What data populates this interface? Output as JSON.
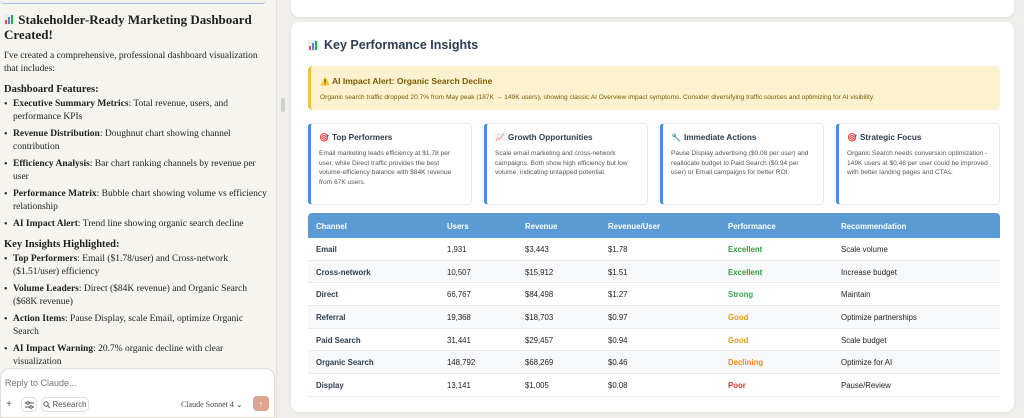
{
  "chat": {
    "title": "Stakeholder-Ready Marketing Dashboard Created!",
    "intro": "I've created a comprehensive, professional dashboard visualization that includes:",
    "features_heading": "Dashboard Features:",
    "features": [
      {
        "bold": "Executive Summary Metrics",
        "text": ": Total revenue, users, and performance KPIs"
      },
      {
        "bold": "Revenue Distribution",
        "text": ": Doughnut chart showing channel contribution"
      },
      {
        "bold": "Efficiency Analysis",
        "text": ": Bar chart ranking channels by revenue per user"
      },
      {
        "bold": "Performance Matrix",
        "text": ": Bubble chart showing volume vs efficiency relationship"
      },
      {
        "bold": "AI Impact Alert",
        "text": ": Trend line showing organic search decline"
      }
    ],
    "insights_heading": "Key Insights Highlighted:",
    "insights": [
      {
        "bold": "Top Performers",
        "text": ": Email ($1.78/user) and Cross-network ($1.51/user) efficiency"
      },
      {
        "bold": "Volume Leaders",
        "text": ": Direct ($84K revenue) and Organic Search ($68K revenue)"
      },
      {
        "bold": "Action Items",
        "text": ": Pause Display, scale Email, optimize Organic Search"
      },
      {
        "bold": "AI Impact Warning",
        "text": ": 20.7% organic decline with clear visualization"
      }
    ],
    "composer": {
      "placeholder": "Reply to Claude...",
      "research_label": "Research",
      "model_label": "Claude Sonnet 4"
    }
  },
  "artifact": {
    "section_title": "Key Performance Insights",
    "alert": {
      "title": "AI Impact Alert: Organic Search Decline",
      "text": "Organic search traffic dropped 20.7% from May peak (187K → 149K users), showing classic AI Overview impact symptoms. Consider diversifying traffic sources and optimizing for AI visibility."
    },
    "cards": [
      {
        "icon": "target-icon",
        "title": "Top Performers",
        "text": "Email marketing leads efficiency at $1.78 per user, while Direct traffic provides the best volume-efficiency balance with $84K revenue from 67K users."
      },
      {
        "icon": "chart-up-icon",
        "title": "Growth Opportunities",
        "text": "Scale email marketing and cross-network campaigns. Both show high efficiency but low volume, indicating untapped potential."
      },
      {
        "icon": "wrench-icon",
        "title": "Immediate Actions",
        "text": "Pause Display advertising ($0.08 per user) and reallocate budget to Paid Search ($0.94 per user) or Email campaigns for better ROI."
      },
      {
        "icon": "target-icon",
        "title": "Strategic Focus",
        "text": "Organic Search needs conversion optimization - 149K users at $0.46 per user could be improved with better landing pages and CTAs."
      }
    ],
    "table": {
      "headers": [
        "Channel",
        "Users",
        "Revenue",
        "Revenue/User",
        "Performance",
        "Recommendation"
      ],
      "rows": [
        {
          "channel": "Email",
          "users": "1,931",
          "revenue": "$3,443",
          "rpu": "$1.78",
          "performance": "Excellent",
          "perf_color": "#2e9e3e",
          "recommendation": "Scale volume"
        },
        {
          "channel": "Cross-network",
          "users": "10,507",
          "revenue": "$15,912",
          "rpu": "$1.51",
          "performance": "Excellent",
          "perf_color": "#2e9e3e",
          "recommendation": "Increase budget"
        },
        {
          "channel": "Direct",
          "users": "66,767",
          "revenue": "$84,498",
          "rpu": "$1.27",
          "performance": "Strong",
          "perf_color": "#3aa64a",
          "recommendation": "Maintain"
        },
        {
          "channel": "Referral",
          "users": "19,368",
          "revenue": "$18,703",
          "rpu": "$0.97",
          "performance": "Good",
          "perf_color": "#e39a14",
          "recommendation": "Optimize partnerships"
        },
        {
          "channel": "Paid Search",
          "users": "31,441",
          "revenue": "$29,457",
          "rpu": "$0.94",
          "performance": "Good",
          "perf_color": "#e39a14",
          "recommendation": "Scale budget"
        },
        {
          "channel": "Organic Search",
          "users": "148,792",
          "revenue": "$68,269",
          "rpu": "$0.46",
          "performance": "Declining",
          "perf_color": "#ef8a1c",
          "recommendation": "Optimize for AI"
        },
        {
          "channel": "Display",
          "users": "13,141",
          "revenue": "$1,005",
          "rpu": "$0.08",
          "performance": "Poor",
          "perf_color": "#d9342b",
          "recommendation": "Pause/Review"
        }
      ]
    }
  }
}
